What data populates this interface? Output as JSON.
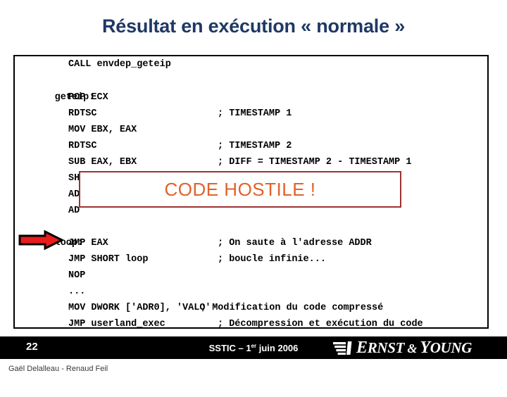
{
  "slide": {
    "title": "Résultat en exécution « normale »",
    "number": "22"
  },
  "code": {
    "lines": [
      {
        "label": "",
        "mnemonic": "CALL envdep_geteip",
        "comment": ""
      },
      {
        "label": "geteip:",
        "mnemonic": "",
        "comment": ""
      },
      {
        "label": "",
        "mnemonic": "POP ECX",
        "comment": ""
      },
      {
        "label": "",
        "mnemonic": "RDTSC",
        "comment": "; TIMESTAMP 1"
      },
      {
        "label": "",
        "mnemonic": "MOV EBX, EAX",
        "comment": ""
      },
      {
        "label": "",
        "mnemonic": "RDTSC",
        "comment": "; TIMESTAMP 2"
      },
      {
        "label": "",
        "mnemonic": "SUB EAX, EBX",
        "comment": "; DIFF = TIMESTAMP 2 - TIMESTAMP 1"
      },
      {
        "label": "",
        "mnemonic": "SH",
        "comment": ""
      },
      {
        "label": "",
        "mnemonic": "AD",
        "comment": ""
      },
      {
        "label": "",
        "mnemonic": "AD",
        "comment": ""
      },
      {
        "label": "loop:",
        "mnemonic": "",
        "comment": ""
      },
      {
        "label": "",
        "mnemonic": "JMP EAX",
        "comment": "; On saute à l'adresse ADDR"
      },
      {
        "label": "",
        "mnemonic": "JMP SHORT loop",
        "comment": "; boucle infinie..."
      },
      {
        "label": "",
        "mnemonic": "NOP",
        "comment": ""
      },
      {
        "label": "",
        "mnemonic": "...",
        "comment": ""
      },
      {
        "label": "",
        "mnemonic": "MOV DWORK ['ADR0], 'VALO'",
        "comment": "; Modification du code compressé"
      },
      {
        "label": "",
        "mnemonic": "JMP userland_exec",
        "comment": "; Décompression et exécution du code"
      }
    ]
  },
  "callout": {
    "label": "CODE HOSTILE !",
    "border_color": "#9E3232",
    "text_color": "#E2622A"
  },
  "arrow": {
    "fill_color": "#E81C1C",
    "stroke_color": "#000000"
  },
  "footer": {
    "conference_prefix": "SSTIC – 1",
    "conference_ordinal": "er",
    "conference_suffix": " juin 2006",
    "brand_ernst": "E",
    "brand_rnst": "RNST",
    "brand_amp": " & ",
    "brand_y": "Y",
    "brand_oung": "OUNG",
    "authors": "Gaël Delalleau - Renaud Feil",
    "bar_color": "#000000"
  }
}
